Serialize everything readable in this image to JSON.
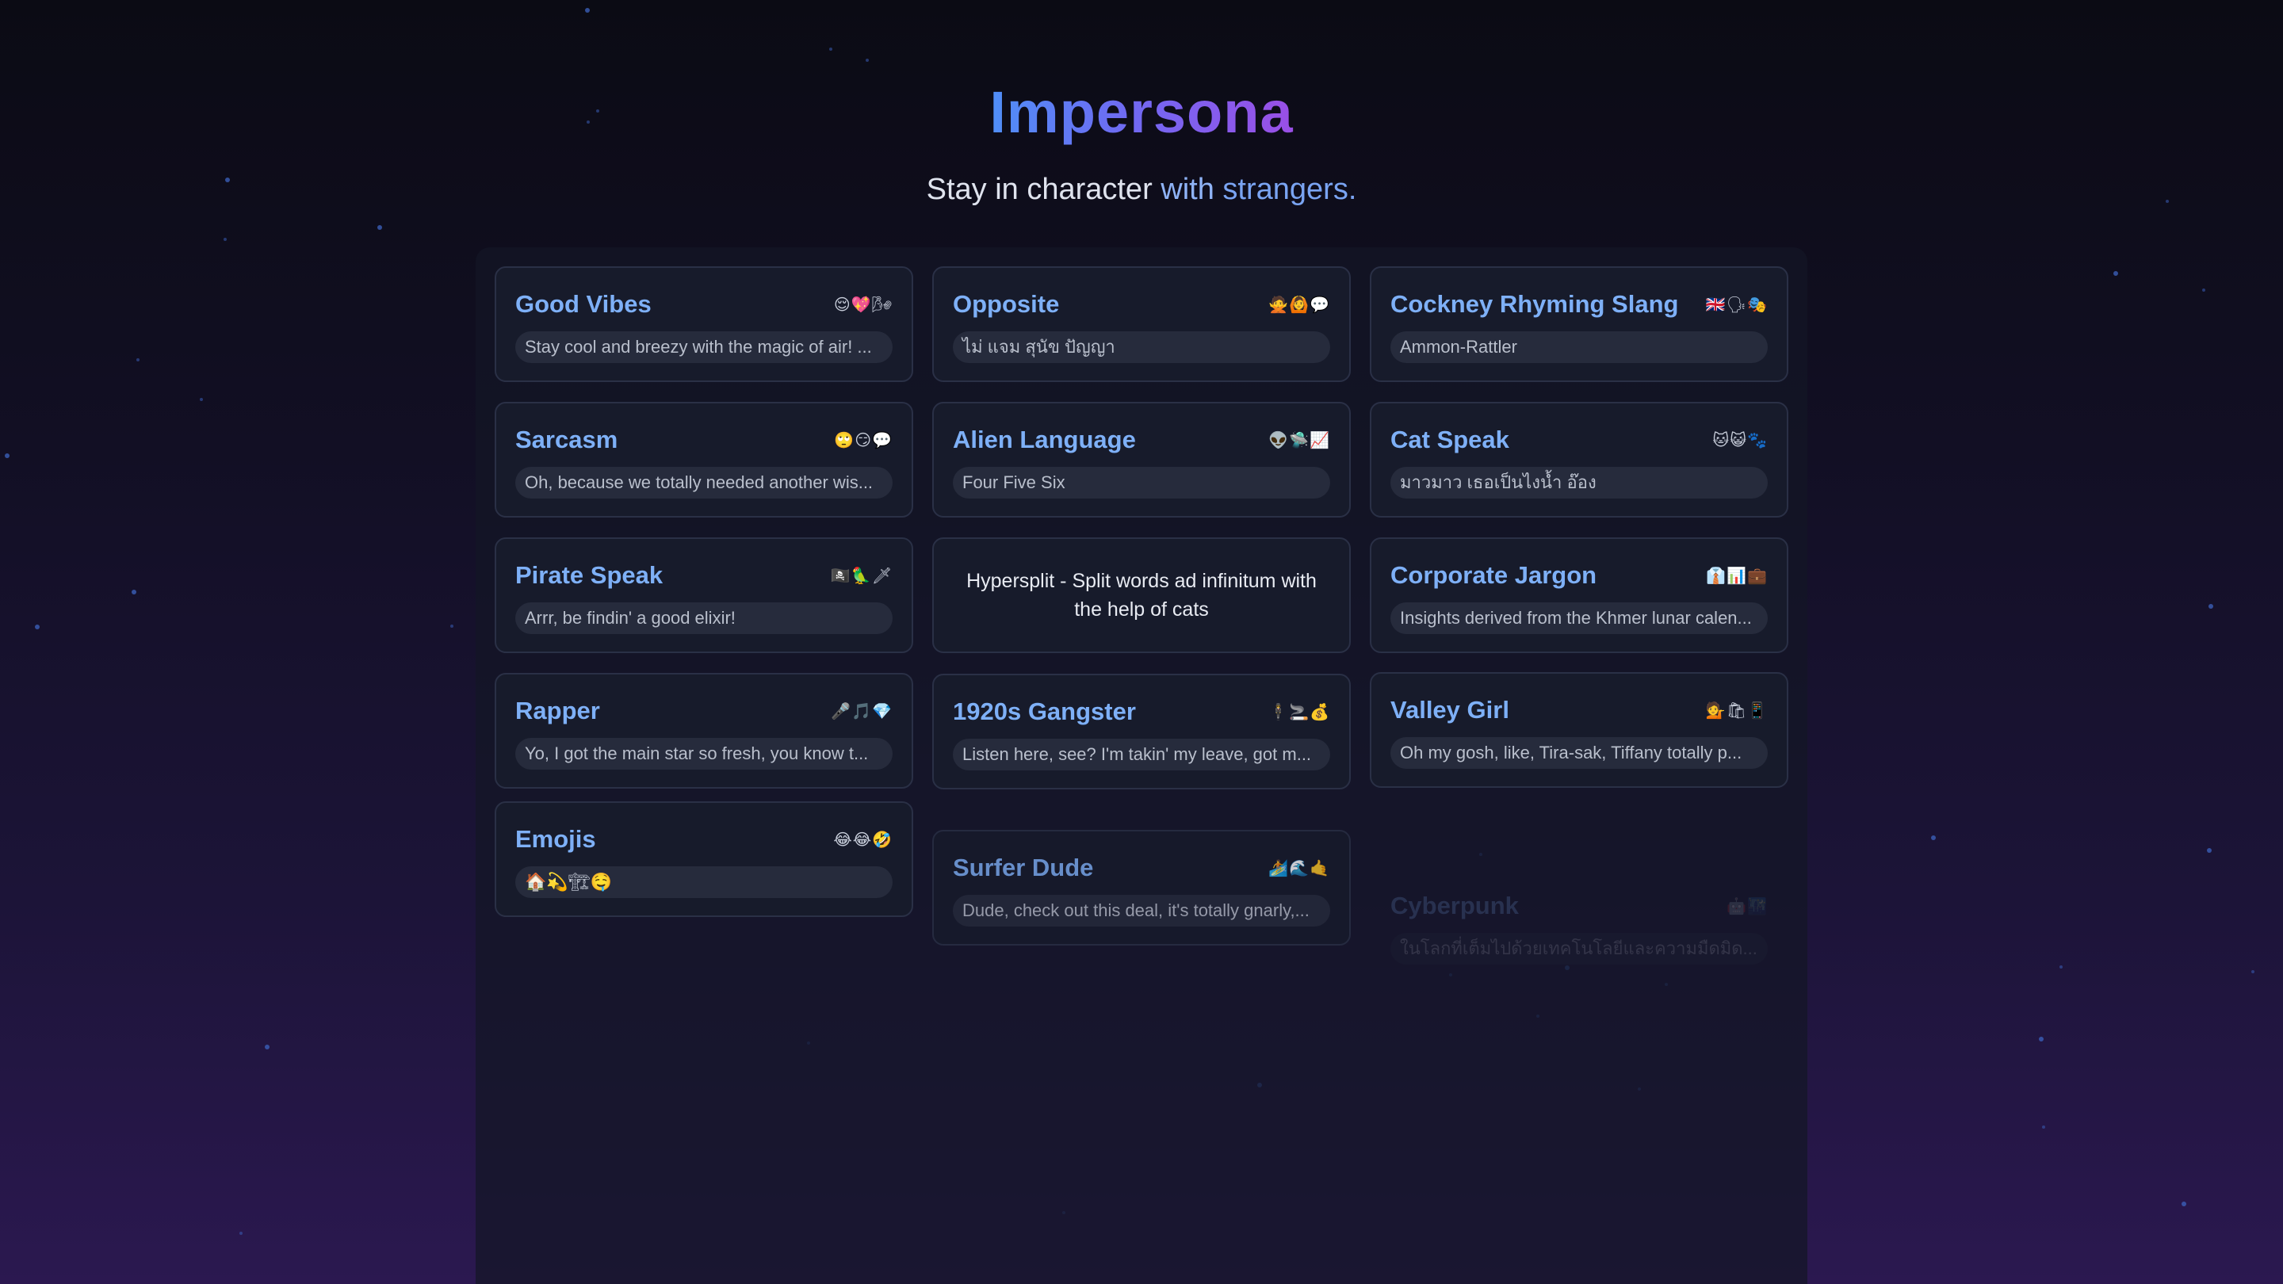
{
  "app": {
    "title": "Impersona",
    "subtitle_part1": "Stay in character ",
    "subtitle_part2": "with ",
    "subtitle_part3": "strangers."
  },
  "personas": [
    {
      "title": "Good Vibes",
      "emojis": "😌💖🌬",
      "sample": "Stay cool and breezy with the magic of air! ..."
    },
    {
      "title": "Opposite",
      "emojis": "🙅🙆💬",
      "sample": "ไม่ แจม สุนัข ปัญญา"
    },
    {
      "title": "Cockney Rhyming Slang",
      "emojis": "🇬🇧🗣🎭",
      "sample": "Ammon-Rattler"
    },
    {
      "title": "Sarcasm",
      "emojis": "🙄😏💬",
      "sample": "Oh, because we totally needed another wis..."
    },
    {
      "title": "Alien Language",
      "emojis": "👽🛸📈",
      "sample": "Four Five Six"
    },
    {
      "title": "Cat Speak",
      "emojis": "🐱😺🐾",
      "sample": "มาวมาว เธอเป็นไงน้ำ อ๊อง"
    },
    {
      "title": "Pirate Speak",
      "emojis": "🏴‍☠️🦜🗡",
      "sample": "Arrr, be findin' a good elixir!"
    },
    {
      "info": "Hypersplit - Split words ad infinitum with the help of cats"
    },
    {
      "title": "Corporate Jargon",
      "emojis": "👔📊💼",
      "sample": "Insights derived from the Khmer lunar calen..."
    },
    {
      "title": "Rapper",
      "emojis": "🎤🎵💎",
      "sample": "Yo, I got the main star so fresh, you know t..."
    },
    {
      "title": "1920s Gangster",
      "emojis": "🕴🚬💰",
      "sample": "Listen here, see? I'm takin' my leave, got m..."
    },
    {
      "title": "Valley Girl",
      "emojis": "💁🛍📱",
      "sample": "Oh my gosh, like, Tira-sak, Tiffany totally p..."
    },
    {
      "title": "Emojis",
      "emojis": "😂😂🤣",
      "sample": "🏠💫🏗🤤"
    },
    {
      "title": "Surfer Dude",
      "emojis": "🏄🌊🤙",
      "sample": "Dude, check out this deal, it's totally gnarly,..."
    },
    {
      "title": "Cyberpunk",
      "emojis": "🤖🌃",
      "sample": "ในโลกที่เต็มไปด้วยเทคโนโลยีและความมืดมิด..."
    }
  ],
  "colors": {
    "accent_blue": "#7eb0f7",
    "title_gradient_start": "#4f8ff7",
    "title_gradient_end": "#9a4fe6",
    "card_bg": "#171b2b",
    "pill_bg": "#262b3c"
  }
}
